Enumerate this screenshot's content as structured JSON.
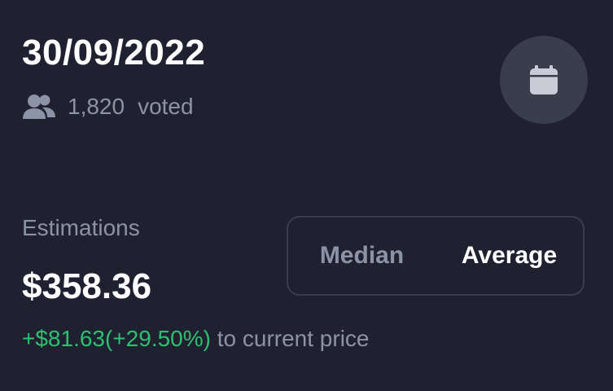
{
  "header": {
    "date": "30/09/2022",
    "voted_count": "1,820",
    "voted_label": "voted"
  },
  "icons": {
    "users": "users-icon",
    "calendar": "calendar-icon"
  },
  "estimations": {
    "label": "Estimations",
    "value": "$358.36",
    "change_value": "+$81.63(+29.50%)",
    "change_suffix": "to current price"
  },
  "toggle": {
    "options": [
      "Median",
      "Average"
    ],
    "selected": "Average"
  },
  "colors": {
    "background": "#1f2130",
    "muted_text": "#8d93a6",
    "primary_text": "#ffffff",
    "positive": "#2fbf71",
    "surface": "#3a3d4c"
  }
}
